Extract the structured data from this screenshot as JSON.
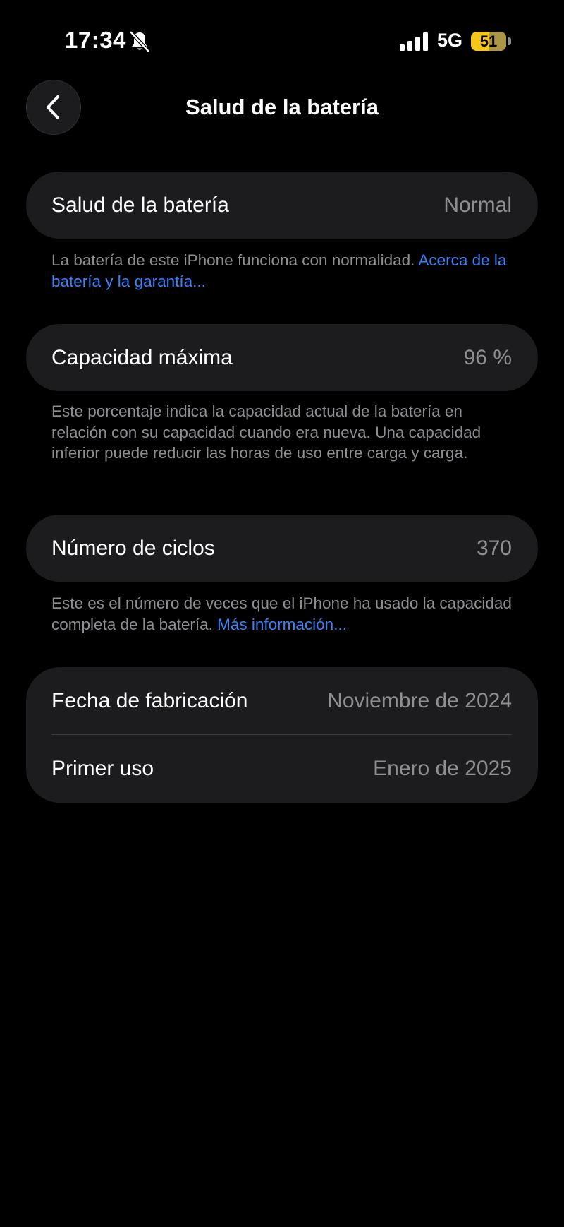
{
  "status_bar": {
    "time": "17:34",
    "network": "5G",
    "battery_level": "51"
  },
  "nav": {
    "title": "Salud de la batería"
  },
  "health": {
    "label": "Salud de la batería",
    "value": "Normal",
    "note": "La batería de este iPhone funciona con normalidad. ",
    "note_link": "Acerca de la batería y la garantía..."
  },
  "capacity": {
    "label": "Capacidad máxima",
    "value": "96 %",
    "note": "Este porcentaje indica la capacidad actual de la batería en relación con su capacidad cuando era nueva. Una capacidad inferior puede reducir las horas de uso entre carga y carga."
  },
  "cycles": {
    "label": "Número de ciclos",
    "value": "370",
    "note": "Este es el número de veces que el iPhone ha usado la capacidad completa de la batería. ",
    "note_link": "Más información..."
  },
  "dates": {
    "manufacture_label": "Fecha de fabricación",
    "manufacture_value": "Noviembre de 2024",
    "first_use_label": "Primer uso",
    "first_use_value": "Enero de 2025"
  },
  "colors": {
    "background": "#000000",
    "card": "#1c1c1e",
    "secondary_text": "#8e8e93",
    "link": "#3b82f6",
    "battery": "#f5c518"
  },
  "icons": {
    "silent": "bell-slash-icon",
    "signal": "cellular-signal-icon",
    "back": "chevron-left-icon"
  }
}
